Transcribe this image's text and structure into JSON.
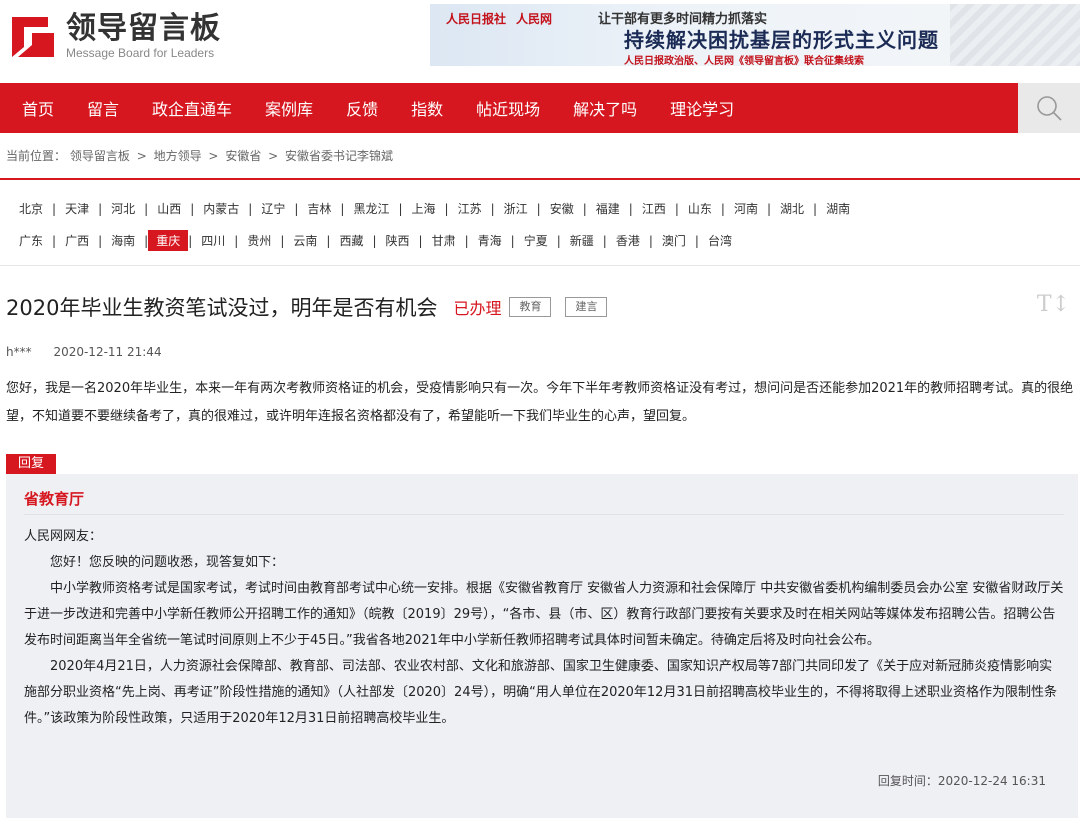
{
  "header": {
    "logo_cn": "领导留言板",
    "logo_en": "Message Board for Leaders",
    "banner": {
      "logo1": "人民日报社",
      "logo2": "人民网",
      "line1": "让干部有更多时间精力抓落实",
      "line2": "持续解决困扰基层的形式主义问题",
      "line3": "人民日报政治版、人民网《领导留言板》联合征集线索"
    }
  },
  "nav": {
    "items": [
      "首页",
      "留言",
      "政企直通车",
      "案例库",
      "反馈",
      "指数",
      "帖近现场",
      "解决了吗",
      "理论学习"
    ]
  },
  "breadcrumb": {
    "prefix": "当前位置：",
    "items": [
      "领导留言板",
      "地方领导",
      "安徽省",
      "安徽省委书记李锦斌"
    ],
    "sep": ">"
  },
  "regions": {
    "row1": [
      "北京",
      "天津",
      "河北",
      "山西",
      "内蒙古",
      "辽宁",
      "吉林",
      "黑龙江",
      "上海",
      "江苏",
      "浙江",
      "安徽",
      "福建",
      "江西",
      "山东",
      "河南",
      "湖北",
      "湖南"
    ],
    "row2": [
      "广东",
      "广西",
      "海南",
      "重庆",
      "四川",
      "贵州",
      "云南",
      "西藏",
      "陕西",
      "甘肃",
      "青海",
      "宁夏",
      "新疆",
      "香港",
      "澳门",
      "台湾"
    ],
    "active": "重庆"
  },
  "post": {
    "title": "2020年毕业生教资笔试没过，明年是否有机会",
    "status": "已办理",
    "tags": [
      "教育",
      "建言"
    ],
    "author": "h***",
    "date": "2020-12-11 21:44",
    "body": "您好，我是一名2020年毕业生，本来一年有两次考教师资格证的机会，受疫情影响只有一次。今年下半年考教师资格证没有考过，想问问是否还能参加2021年的教师招聘考试。真的很绝望，不知道要不要继续备考了，真的很难过，或许明年连报名资格都没有了，希望能听一下我们毕业生的心声，望回复。",
    "font_button": "T↕"
  },
  "reply": {
    "label": "回复",
    "org": "省教育厅",
    "paragraphs": [
      "人民网网友：",
      "您好！您反映的问题收悉，现答复如下：",
      "中小学教师资格考试是国家考试，考试时间由教育部考试中心统一安排。根据《安徽省教育厅 安徽省人力资源和社会保障厅 中共安徽省委机构编制委员会办公室 安徽省财政厅关于进一步改进和完善中小学新任教师公开招聘工作的通知》（皖教〔2019〕29号），“各市、县（市、区）教育行政部门要按有关要求及时在相关网站等媒体发布招聘公告。招聘公告发布时间距离当年全省统一笔试时间原则上不少于45日。”我省各地2021年中小学新任教师招聘考试具体时间暂未确定。待确定后将及时向社会公布。",
      "2020年4月21日，人力资源社会保障部、教育部、司法部、农业农村部、文化和旅游部、国家卫生健康委、国家知识产权局等7部门共同印发了《关于应对新冠肺炎疫情影响实施部分职业资格“先上岗、再考证”阶段性措施的通知》（人社部发〔2020〕24号），明确“用人单位在2020年12月31日前招聘高校毕业生的，不得将取得上述职业资格作为限制性条件。”该政策为阶段性政策，只适用于2020年12月31日前招聘高校毕业生。"
    ],
    "time": "回复时间：2020-12-24 16:31"
  },
  "colors": {
    "accent": "#d6171f",
    "reply_bg": "#eef0f4",
    "search_bg": "#e9e9e9"
  }
}
